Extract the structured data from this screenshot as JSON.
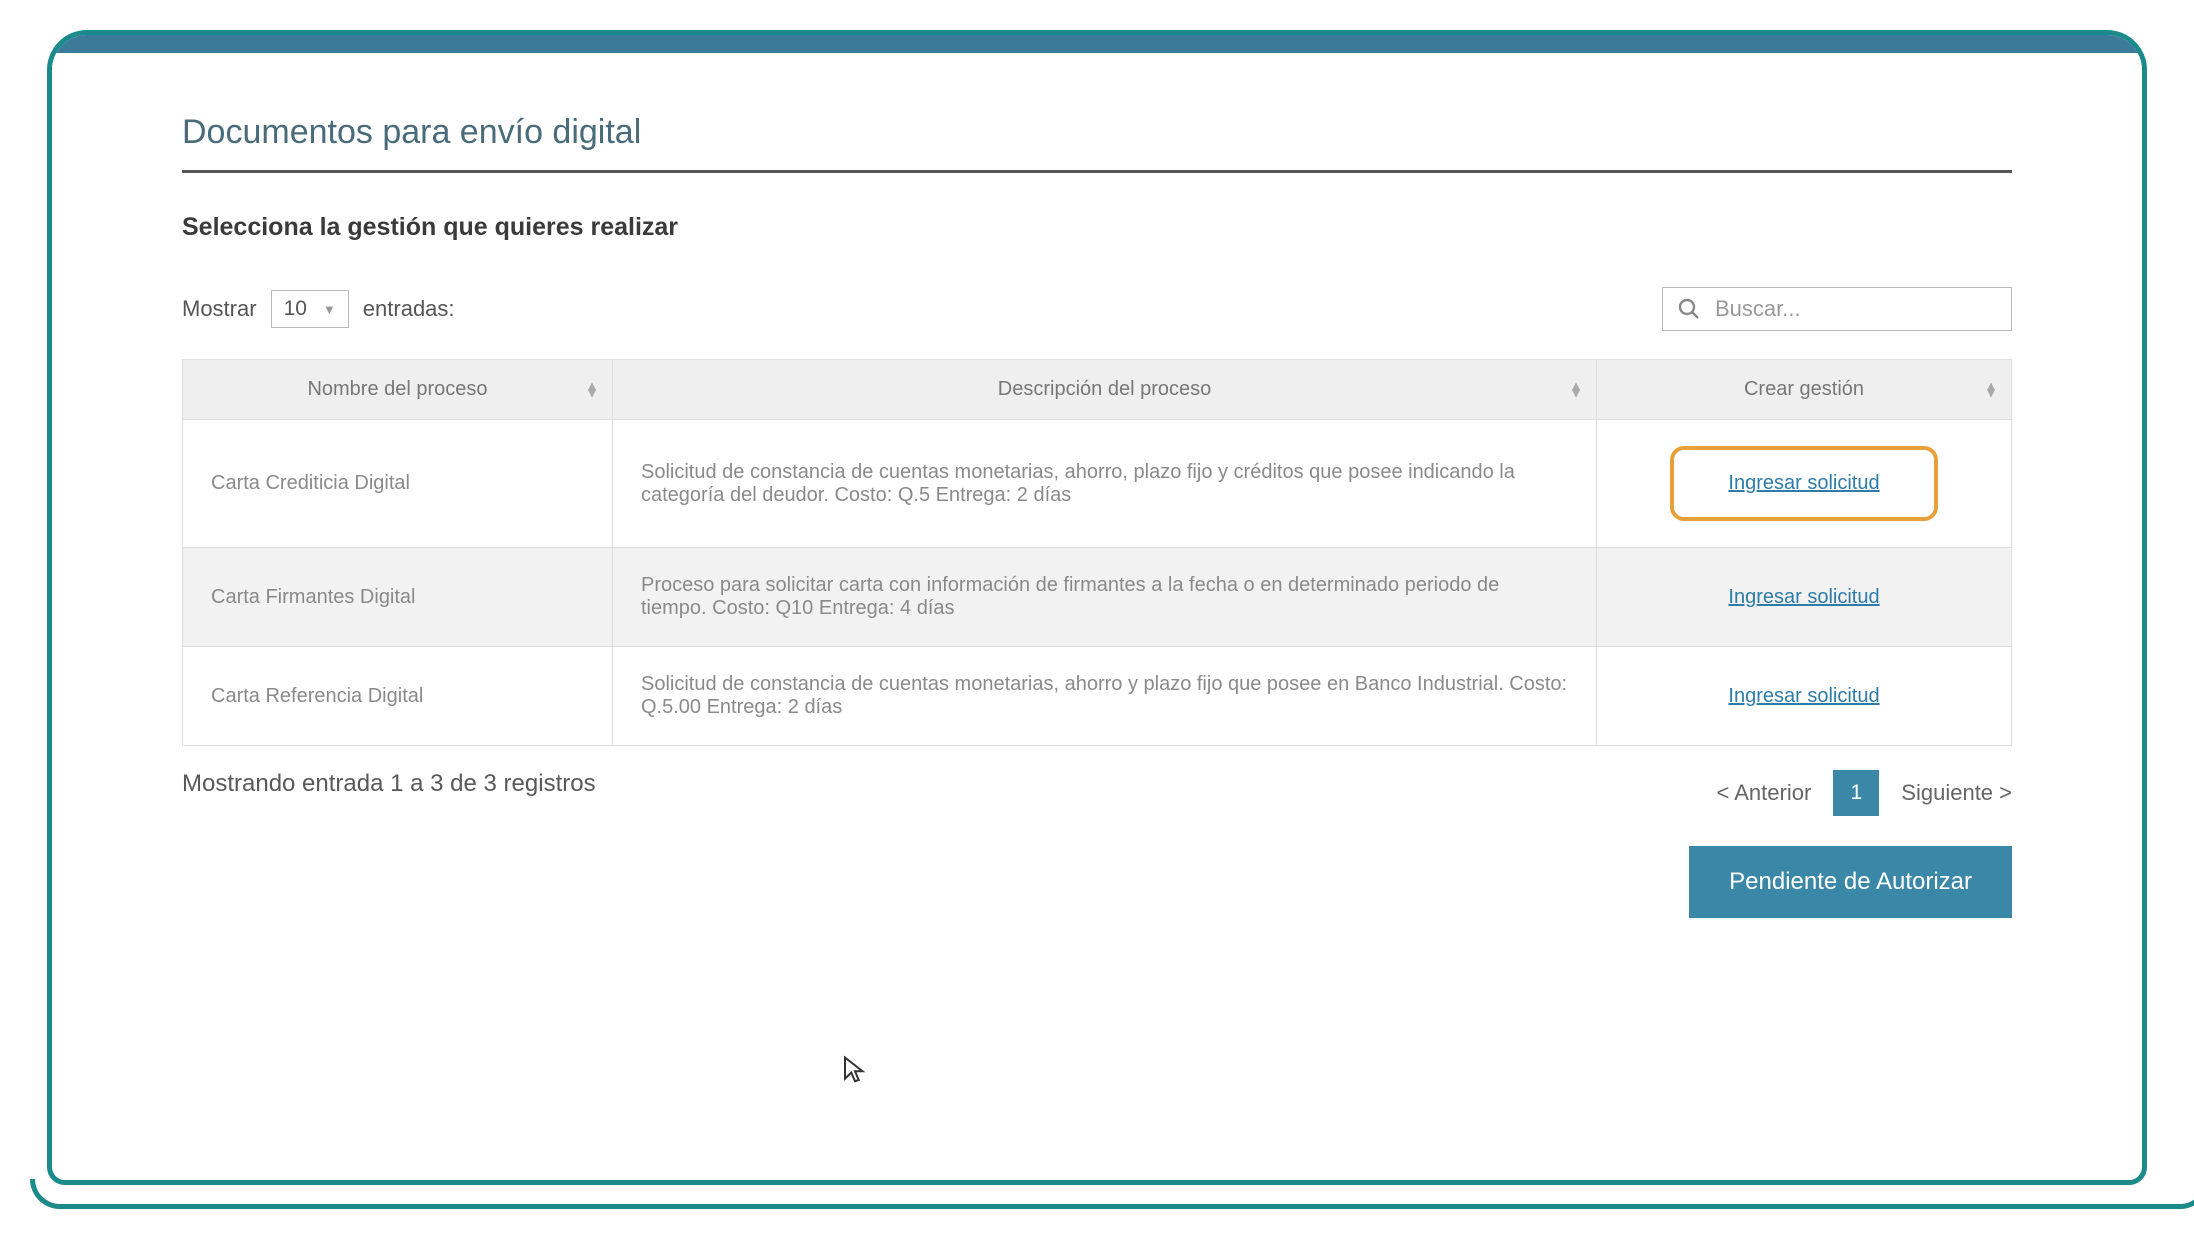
{
  "page": {
    "title": "Documentos para envío digital",
    "subtitle": "Selecciona la gestión que quieres realizar"
  },
  "controls": {
    "show_label": "Mostrar",
    "entries_label": "entradas:",
    "select_value": "10",
    "search_placeholder": "Buscar..."
  },
  "table": {
    "headers": {
      "name": "Nombre del proceso",
      "desc": "Descripción del proceso",
      "action": "Crear gestión"
    },
    "rows": [
      {
        "name": "Carta Crediticia Digital",
        "desc": "Solicitud de constancia de cuentas monetarias, ahorro, plazo fijo y créditos que posee indicando la categoría del deudor. Costo: Q.5 Entrega: 2 días",
        "action": "Ingresar solicitud",
        "highlighted": true
      },
      {
        "name": "Carta Firmantes Digital",
        "desc": "Proceso para solicitar carta con información de firmantes a la fecha o en determinado periodo de tiempo. Costo: Q10 Entrega: 4 días",
        "action": "Ingresar solicitud",
        "highlighted": false
      },
      {
        "name": "Carta Referencia Digital",
        "desc": "Solicitud de constancia de cuentas monetarias, ahorro y plazo fijo que posee en Banco Industrial. Costo: Q.5.00 Entrega: 2 días",
        "action": "Ingresar solicitud",
        "highlighted": false
      }
    ]
  },
  "footer": {
    "info": "Mostrando entrada 1 a 3 de 3 registros",
    "prev": "< Anterior",
    "page": "1",
    "next": "Siguiente >",
    "auth_button": "Pendiente de Autorizar"
  }
}
